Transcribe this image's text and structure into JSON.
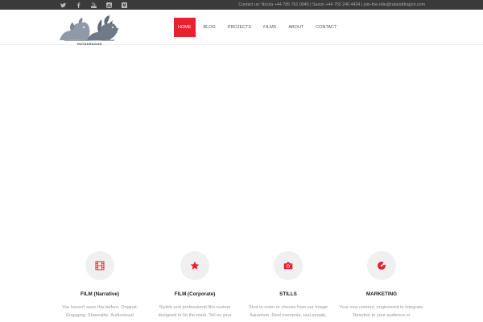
{
  "topbar": {
    "social": [
      "twitter-icon",
      "facebook-icon",
      "youtube-icon",
      "instagram-icon",
      "vimeo-icon"
    ],
    "contact_text": "Contact us: Nicola +44 785 761 0945 | Saxon +44 755 246 4434 | join-the-ride@ratanddragon.com"
  },
  "logo": {
    "text": "RAT&DRAGON"
  },
  "nav": {
    "items": [
      {
        "label": "HOME"
      },
      {
        "label": "BLOG"
      },
      {
        "label": "PROJECTS"
      },
      {
        "label": "FILMS"
      },
      {
        "label": "ABOUT"
      },
      {
        "label": "CONTACT"
      }
    ]
  },
  "features": [
    {
      "icon": "film-icon",
      "title": "FILM (Narrative)",
      "desc": "You haven't seen this before. Original. Engaging. Shareable. Audiovisual"
    },
    {
      "icon": "star-icon",
      "title": "FILM (Corporate)",
      "desc": "Stylish and professional film custom designed to hit the mark. Tell us your"
    },
    {
      "icon": "camera-icon",
      "title": "STILLS",
      "desc": "Shot to order or choose from our Image Aquarium. Real moments, real people,"
    },
    {
      "icon": "target-icon",
      "title": "MARKETING",
      "desc": "Your new content, engineered to integrate. Reactive to your audience or"
    }
  ],
  "colors": {
    "accent": "#e8212f",
    "topbar": "#3a3a3a",
    "icon_circle": "#f0f0f0"
  }
}
